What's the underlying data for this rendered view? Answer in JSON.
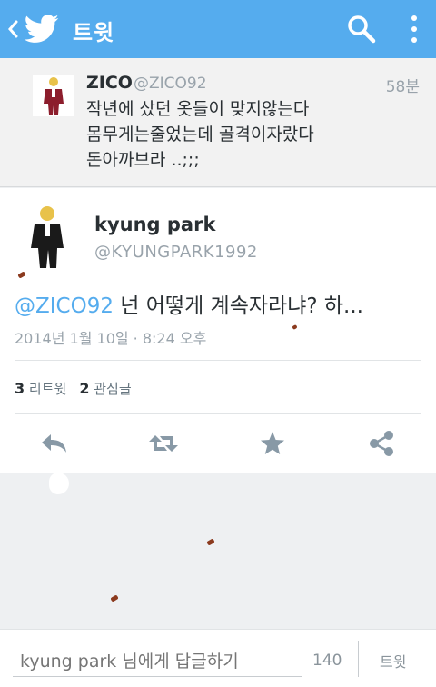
{
  "appbar": {
    "title": "트윗",
    "color": "#55acee",
    "icons": [
      "back-icon",
      "twitter-bird-icon",
      "search-icon",
      "overflow-menu-icon"
    ]
  },
  "parent_tweet": {
    "name": "ZICO",
    "handle": "@ZICO92",
    "time": "58분",
    "text": "작년에 샀던 옷들이 맞지않는다\n몸무게는줄었는데 골격이자랐다\n돈아까브라 ..;;;"
  },
  "main_tweet": {
    "name": "kyung park",
    "handle": "@KYUNGPARK1992",
    "mention": "@ZICO92",
    "text": " 넌 어떻게 계속자라냐? 하...",
    "timestamp": "2014년 1월 10일 · 8:24 오후",
    "retweets_count": "3",
    "retweets_label": "리트윗",
    "favorites_count": "2",
    "favorites_label": "관심글",
    "actions": [
      "reply-icon",
      "retweet-icon",
      "favorite-star-icon",
      "share-icon"
    ]
  },
  "reply_bar": {
    "placeholder": "kyung park 님에게 답글하기",
    "char_count": "140",
    "tweet_button": "트윗"
  }
}
